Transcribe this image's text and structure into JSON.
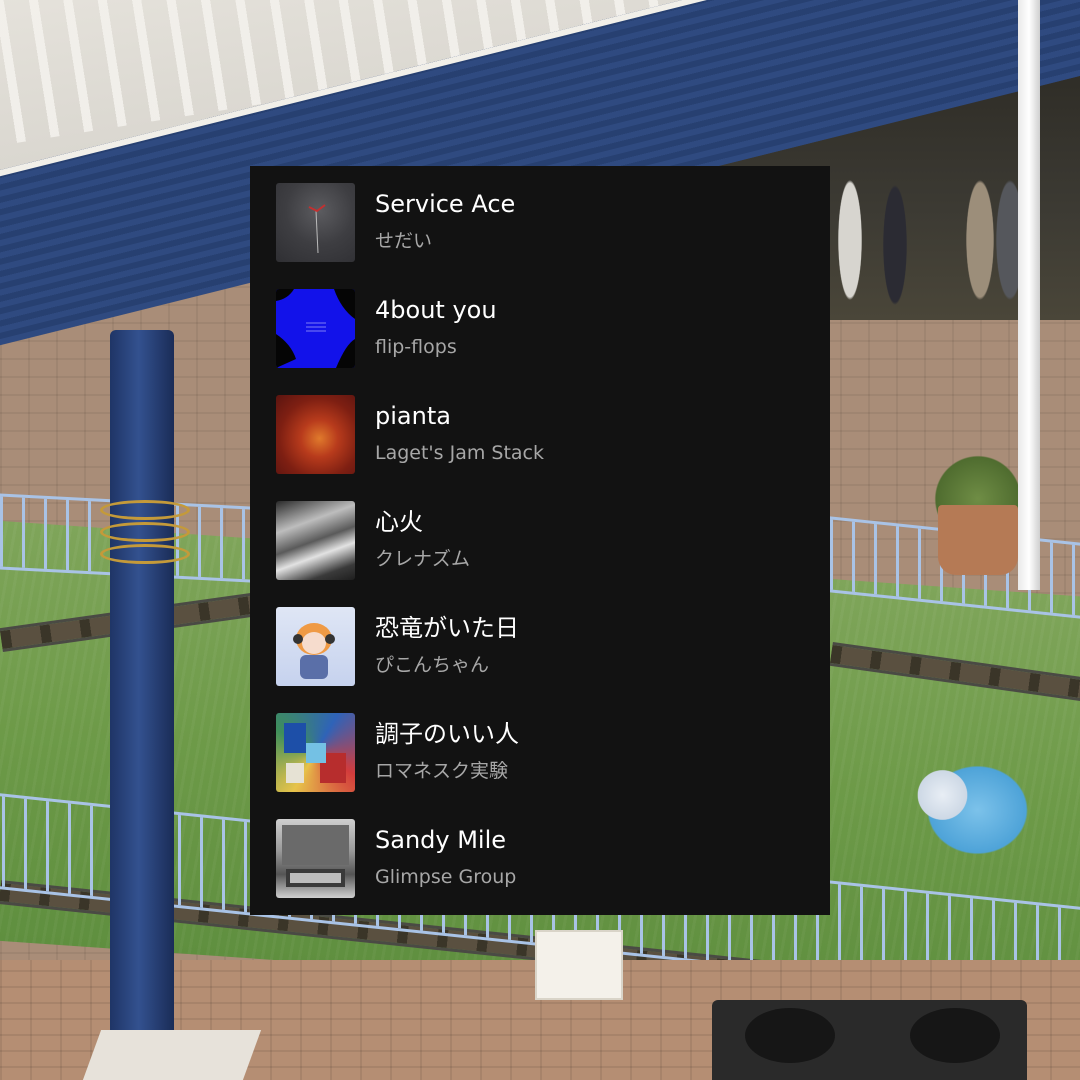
{
  "playlist": {
    "tracks": [
      {
        "title": "Service Ace",
        "artist": "せだい",
        "cover_colors": [
          "#3b3b3e",
          "#505052"
        ],
        "cover_icon": "album-cover-grey-sky"
      },
      {
        "title": "4bout you",
        "artist": "flip-flops",
        "cover_colors": [
          "#1111e8",
          "#0a0a0a"
        ],
        "cover_icon": "album-cover-blue"
      },
      {
        "title": "pianta",
        "artist": "Laget's Jam Stack",
        "cover_colors": [
          "#9b2a18",
          "#d0602b"
        ],
        "cover_icon": "album-cover-red-orb"
      },
      {
        "title": "心火",
        "artist": "クレナズム",
        "cover_colors": [
          "#8a8a8a",
          "#2a2a2a"
        ],
        "cover_icon": "album-cover-silver-foil"
      },
      {
        "title": "恐竜がいた日",
        "artist": "ぴこんちゃん",
        "cover_colors": [
          "#c9d6ef",
          "#f0a24c"
        ],
        "cover_icon": "album-cover-anime-girl"
      },
      {
        "title": "調子のいい人",
        "artist": "ロマネスク実験",
        "cover_colors": [
          "#3a6bb5",
          "#c23b3b"
        ],
        "cover_icon": "album-cover-collage"
      },
      {
        "title": "Sandy Mile",
        "artist": "Glimpse Group",
        "cover_colors": [
          "#d9d9d9",
          "#4a4a4a"
        ],
        "cover_icon": "album-cover-bw-photo"
      }
    ]
  },
  "theme": {
    "panel_bg": "#121212",
    "title_color": "#ffffff",
    "artist_color": "#a7a7a7"
  }
}
